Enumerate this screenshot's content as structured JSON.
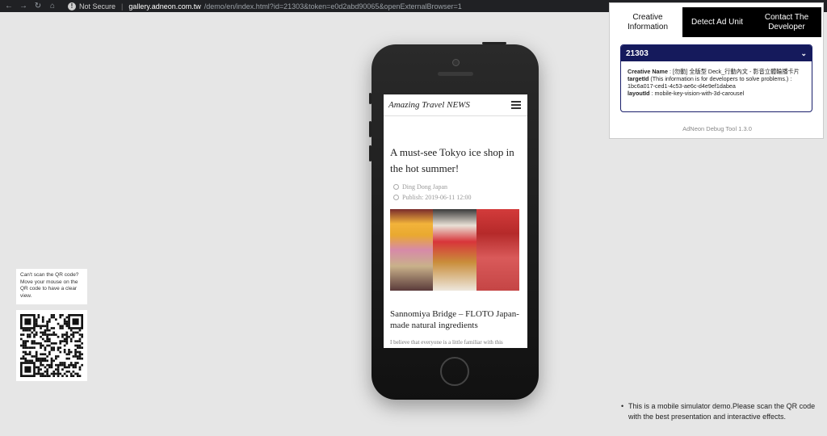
{
  "browser": {
    "not_secure": "Not Secure",
    "host": "gallery.adneon.com.tw",
    "path": "/demo/en/index.html?id=21303&token=e0d2abd90065&openExternalBrowser=1"
  },
  "site": {
    "logo": "Amazing Travel NEWS",
    "article_title": "A must-see Tokyo ice shop in the hot summer!",
    "author": "Ding Dong Japan",
    "publish": "Publish: 2019-06-11 12:00",
    "sub_title": "Sannomiya Bridge – FLOTO Japan-made natural ingredients",
    "body_text": "I believe that everyone is a little familiar with this"
  },
  "debug_panel": {
    "tabs": [
      "Creative Information",
      "Detect Ad Unit",
      "Contact The Developer"
    ],
    "card_id": "21303",
    "creative_name_label": "Creative Name",
    "creative_name_value": ": [勿動] 全版型 Deck_行動內文 - 影音立體輪播卡片",
    "target_label": "targetId",
    "target_note": "(This information is for developers to solve problems.) : 1bc6a017-ced1-4c53-ae6c-d4e9ef1dabea",
    "layout_label": "layoutId",
    "layout_value": ": mobile-key-vision-with-3d-carousel",
    "version": "AdNeon Debug Tool 1.3.0"
  },
  "qr_note": "Can't scan the QR code? Move your mouse on the QR code to have a clear view.",
  "bottom_note": "This is a mobile simulator demo.Please scan the QR code with the best presentation and interactive effects.",
  "icons": {
    "back": "back-arrow-icon",
    "forward": "forward-arrow-icon",
    "reload": "reload-icon",
    "home": "home-icon",
    "warning": "warning-icon",
    "menu": "hamburger-menu-icon",
    "chevron": "chevron-down-icon"
  },
  "colors": {
    "panel_header": "#151a5c",
    "background": "#e6e6e6"
  }
}
